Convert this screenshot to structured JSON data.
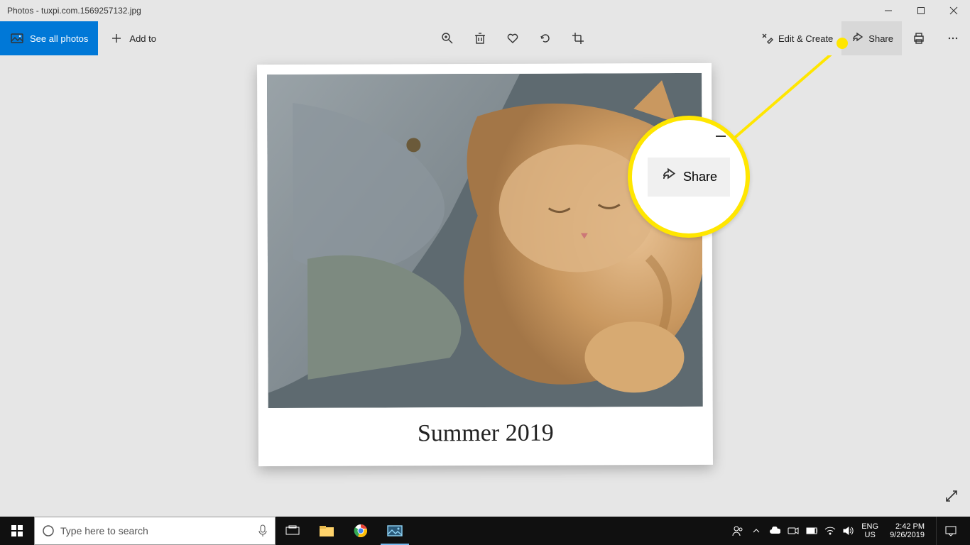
{
  "titlebar": {
    "title": "Photos - tuxpi.com.1569257132.jpg"
  },
  "toolbar": {
    "see_all": "See all photos",
    "add_to": "Add to",
    "edit_create": "Edit & Create",
    "share": "Share"
  },
  "photo": {
    "caption": "Summer 2019"
  },
  "callout": {
    "share": "Share"
  },
  "taskbar": {
    "search_placeholder": "Type here to search",
    "lang_top": "ENG",
    "lang_bottom": "US",
    "time": "2:42 PM",
    "date": "9/26/2019"
  }
}
